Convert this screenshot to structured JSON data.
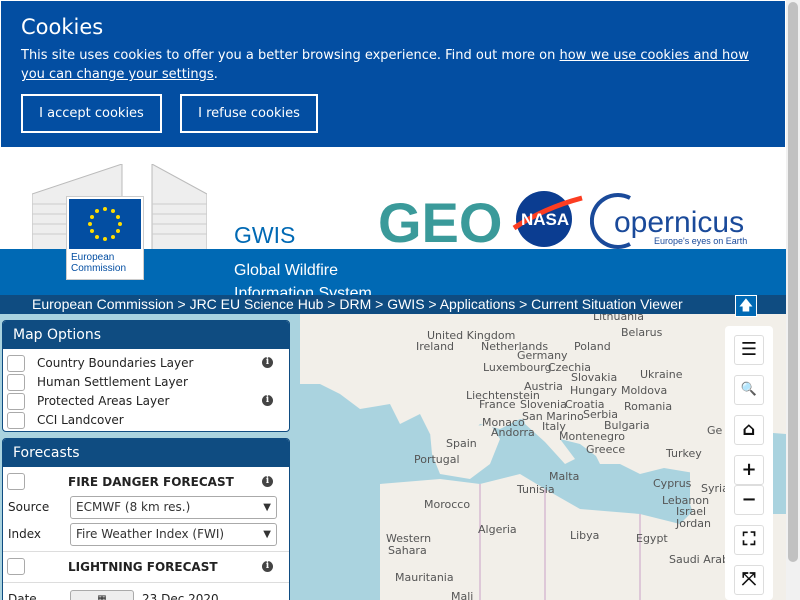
{
  "cookie_banner": {
    "title": "Cookies",
    "text_prefix": "This site uses cookies to offer you a better browsing experience. Find out more on ",
    "link_text": "how we use cookies and how you can change your settings",
    "text_suffix": ".",
    "accept_label": "I accept cookies",
    "refuse_label": "I refuse cookies"
  },
  "header": {
    "ec_logo_text_1": "European",
    "ec_logo_text_2": "Commission",
    "site_title": "GWIS",
    "site_subtitle": "Global Wildfire Information System",
    "geo_logo": "GEO",
    "nasa_logo": "NASA",
    "copernicus_logo": "opernicus",
    "copernicus_tagline": "Europe's eyes on Earth",
    "up_icon": "arrow-up-icon"
  },
  "breadcrumb": "European Commission > JRC EU Science Hub > DRM > GWIS > Applications > Current Situation Viewer",
  "map_options": {
    "title": "Map Options",
    "layers": [
      {
        "label": "Country Boundaries Layer",
        "info": "i"
      },
      {
        "label": "Human Settlement Layer",
        "info": ""
      },
      {
        "label": "Protected Areas Layer",
        "info": "i"
      },
      {
        "label": "CCI Landcover",
        "info": ""
      }
    ]
  },
  "forecasts": {
    "title": "Forecasts",
    "fire_danger": {
      "label": "FIRE DANGER FORECAST",
      "info": "i",
      "source_label": "Source",
      "source_value": "ECMWF (8 km res.)",
      "index_label": "Index",
      "index_value": "Fire Weather Index (FWI)"
    },
    "lightning": {
      "label": "LIGHTNING FORECAST",
      "info": "i",
      "date_label": "Date",
      "date_value": "23 Dec 2020"
    }
  },
  "map_labels": [
    "Lithuania",
    "United Kingdom",
    "Belarus",
    "Ireland",
    "Netherlands",
    "Poland",
    "Germany",
    "Luxembourg",
    "Czechia",
    "Slovakia",
    "Ukraine",
    "Austria",
    "Hungary",
    "Moldova",
    "Liechtenstein",
    "France",
    "Slovenia",
    "Croatia",
    "Romania",
    "Serbia",
    "San Marino",
    "Monaco",
    "Andorra",
    "Italy",
    "Montenegro",
    "Bulgaria",
    "Ge",
    "Spain",
    "Greece",
    "Turkey",
    "Portugal",
    "Tunisia",
    "Malta",
    "Cyprus",
    "Syria",
    "Lebanon",
    "Morocco",
    "Israel",
    "Jordan",
    "Algeria",
    "Libya",
    "Egypt",
    "Western",
    "Sahara",
    "Saudi Arab",
    "Mauritania",
    "Mali"
  ],
  "tools": [
    {
      "name": "menu-icon",
      "glyph": "☰"
    },
    {
      "name": "search-icon",
      "glyph": "🔍"
    },
    {
      "name": "home-icon",
      "glyph": "⌂"
    },
    {
      "name": "zoom-in-icon",
      "glyph": "+"
    },
    {
      "name": "zoom-out-icon",
      "glyph": "−"
    },
    {
      "name": "fullscreen-icon",
      "glyph": "⛶"
    },
    {
      "name": "extent-icon",
      "glyph": "⤧"
    }
  ],
  "colors": {
    "cookie_bg": "#034ea2",
    "header_blue": "#0069b4",
    "breadcrumb_bg": "#0f4c81",
    "sea": "#aad3df",
    "land": "#f2efe9"
  }
}
